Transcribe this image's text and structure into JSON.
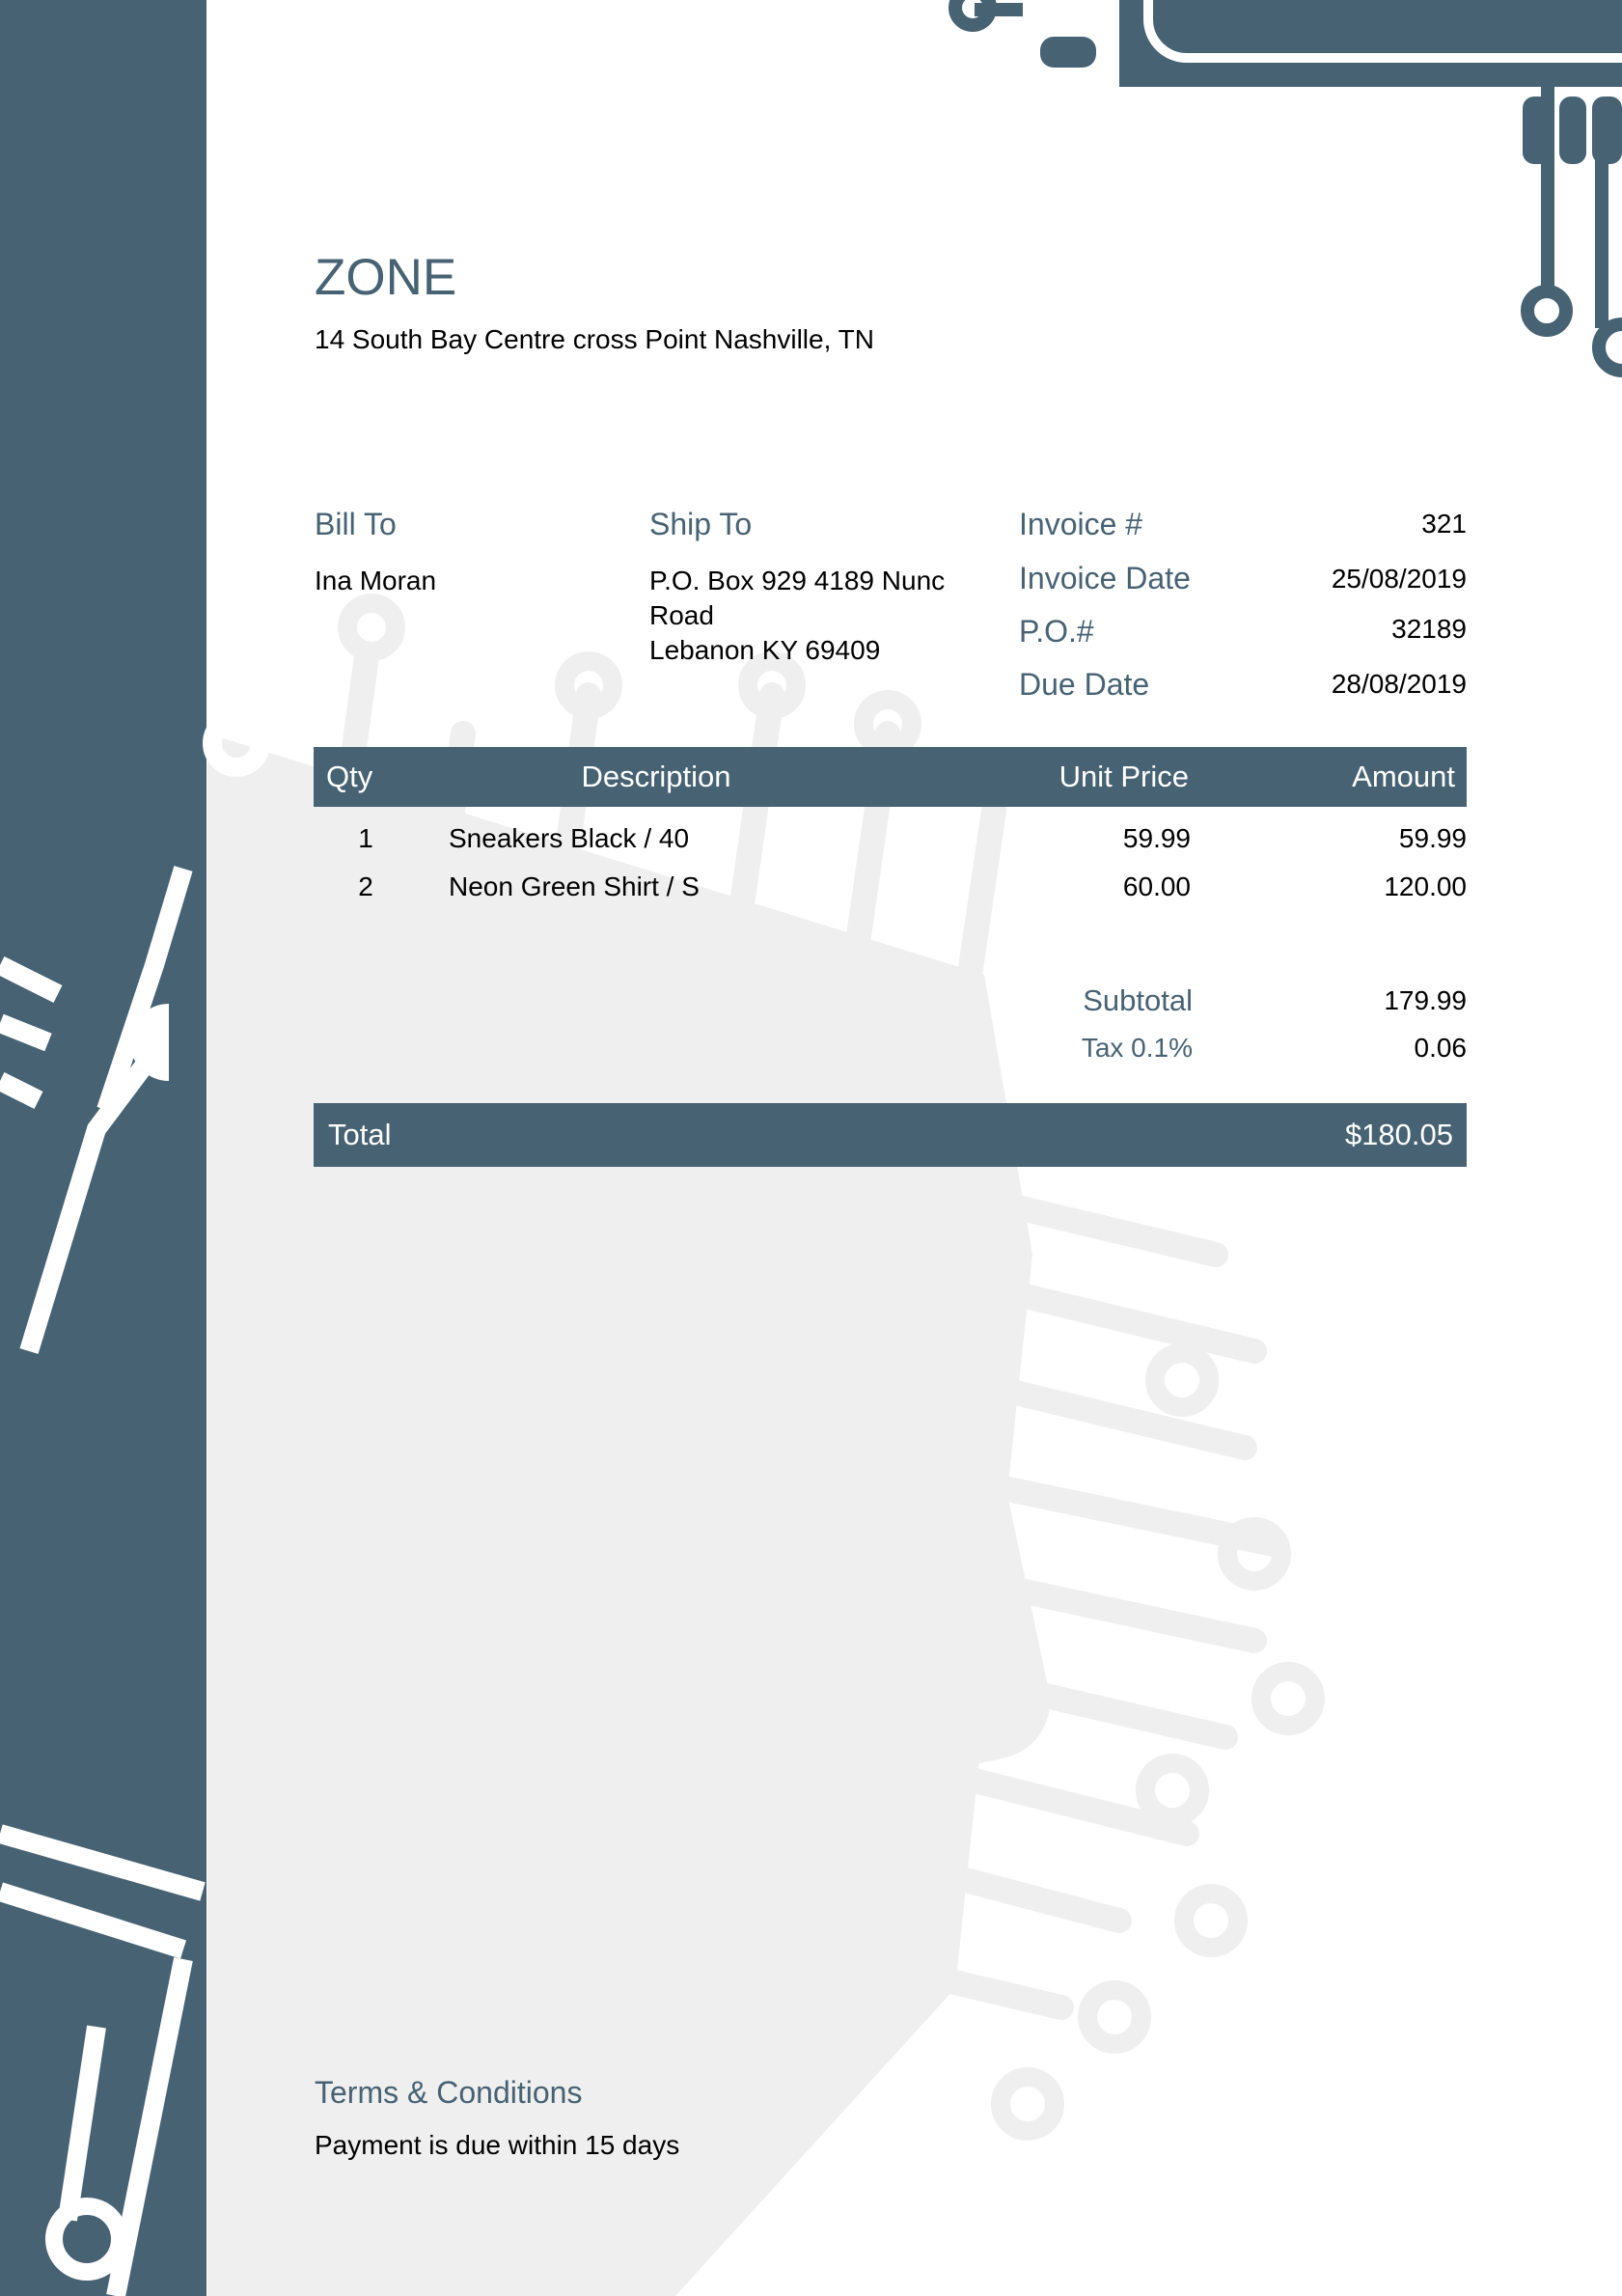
{
  "company": {
    "name": "ZONE",
    "address": "14 South Bay Centre cross Point Nashville, TN"
  },
  "bill_to": {
    "label": "Bill To",
    "name": "Ina Moran"
  },
  "ship_to": {
    "label": "Ship To",
    "lines": [
      "P.O. Box 929 4189 Nunc",
      "Road",
      "Lebanon KY 69409"
    ]
  },
  "meta": [
    {
      "label": "Invoice #",
      "value": "321"
    },
    {
      "label": "Invoice Date",
      "value": "25/08/2019"
    },
    {
      "label": "P.O.#",
      "value": "32189"
    },
    {
      "label": "Due Date",
      "value": "28/08/2019"
    }
  ],
  "table": {
    "headers": [
      "Qty",
      "Description",
      "Unit Price",
      "Amount"
    ],
    "rows": [
      [
        "1",
        "Sneakers Black / 40",
        "59.99",
        "59.99"
      ],
      [
        "2",
        "Neon Green Shirt / S",
        "60.00",
        "120.00"
      ]
    ]
  },
  "summary": {
    "subtotal_label": "Subtotal",
    "subtotal_value": "179.99",
    "tax_label": "Tax 0.1%",
    "tax_value": "0.06",
    "total_label": "Total",
    "total_value": "$180.05"
  },
  "terms": {
    "title": "Terms & Conditions",
    "text": "Payment is due within 15 days"
  },
  "colors": {
    "accent": "#476273",
    "watermark": "#efefef"
  }
}
